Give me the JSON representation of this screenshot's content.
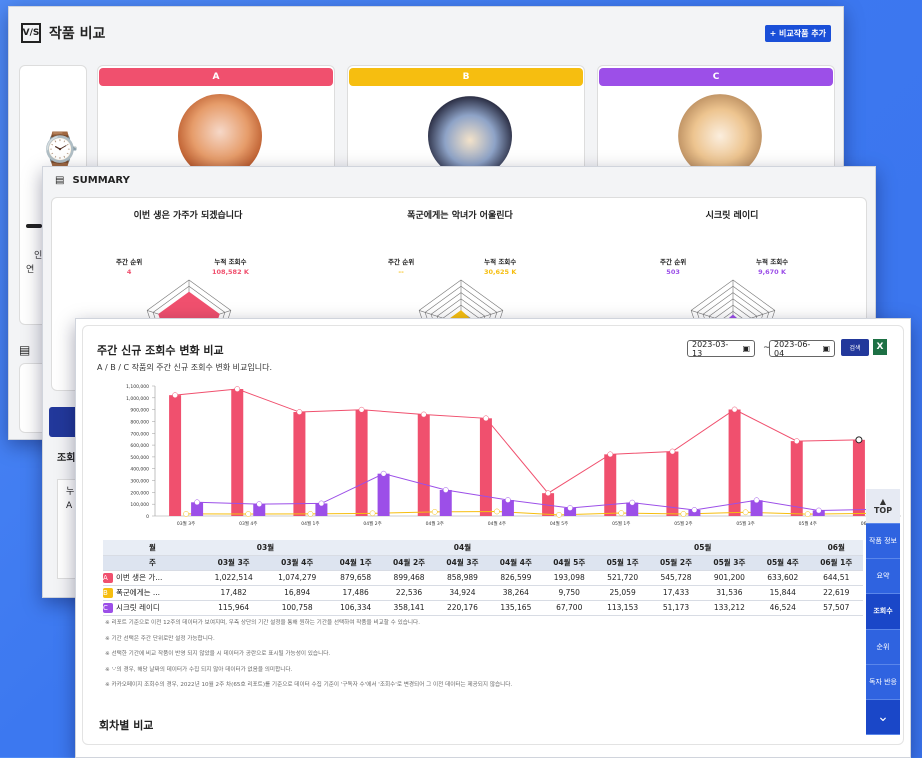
{
  "win1": {
    "title": "작품 비교",
    "add_label": "+ 비교작품 추가",
    "cards": [
      {
        "label": "A",
        "color": "#f0506e"
      },
      {
        "label": "B",
        "color": "#f6be10"
      },
      {
        "label": "C",
        "color": "#9c4fe8"
      }
    ],
    "side_lines": [
      "인",
      "연"
    ],
    "doc_letter": "A"
  },
  "summary": {
    "title": "SUMMARY",
    "works": [
      {
        "title": "이번 생은 가주가 되겠습니다",
        "rank_label": "주간 순위",
        "rank_value": "4",
        "views_label": "누적 조회수",
        "views_value": "108,582 K",
        "color": "#f0506e"
      },
      {
        "title": "폭군에게는 악녀가 어울린다",
        "rank_label": "주간 순위",
        "rank_value": "--",
        "views_label": "누적 조회수",
        "views_value": "30,625 K",
        "color": "#f6be10"
      },
      {
        "title": "시크릿 레이디",
        "rank_label": "주간 순위",
        "rank_value": "503",
        "views_label": "누적 조회수",
        "views_value": "9,670 K",
        "color": "#9c4fe8"
      }
    ],
    "side_label": "조회",
    "side_box_label": "누"
  },
  "weekly": {
    "title": "주간 신규 조회수 변화 비교",
    "subtitle": "A / B / C 작품의 주간 신규 조회수 변화 비교입니다.",
    "date_from": "2023-03-13",
    "date_to": "2023-06-04",
    "tilde": "~",
    "search_label": "검색",
    "excel_label": "X",
    "months": [
      {
        "label": "월"
      },
      {
        "label": "03월"
      },
      {
        "label": "04월"
      },
      {
        "label": "05월"
      },
      {
        "label": "06월"
      }
    ],
    "week_header": "주",
    "weeks": [
      "03월 3주",
      "03월 4주",
      "04월 1주",
      "04월 2주",
      "04월 3주",
      "04월 4주",
      "04월 5주",
      "05월 1주",
      "05월 2주",
      "05월 3주",
      "05월 4주",
      "06월 1주"
    ],
    "rows": [
      {
        "badge": "A",
        "name": "이번 생은 가...",
        "color": "#f0506e",
        "values": [
          "1,022,514",
          "1,074,279",
          "879,658",
          "899,468",
          "858,989",
          "826,599",
          "193,098",
          "521,720",
          "545,728",
          "901,200",
          "633,602",
          "644,51"
        ]
      },
      {
        "badge": "B",
        "name": "폭군에게는 ...",
        "color": "#f6be10",
        "values": [
          "17,482",
          "16,894",
          "17,486",
          "22,536",
          "34,924",
          "38,264",
          "9,750",
          "25,059",
          "17,433",
          "31,536",
          "15,844",
          "22,619"
        ]
      },
      {
        "badge": "C",
        "name": "시크릿 레이디",
        "color": "#9c4fe8",
        "values": [
          "115,964",
          "100,758",
          "106,334",
          "358,141",
          "220,176",
          "135,165",
          "67,700",
          "113,153",
          "51,173",
          "133,212",
          "46,524",
          "57,507"
        ]
      }
    ],
    "notes": [
      "※ 리포트 기준으로 이전 12주의 데이터가 보여지며, 우측 상단의 기간 설정을 통해 원하는 기간을 선택하여 작품을 비교할 수 있습니다.",
      "※ 기간 선택은 주간 단위로만 설정 가능합니다.",
      "※ 선택한 기간에 비교 작품이 반영 되지 않았을 시 데이터가 공란으로 표시될 가능성이 있습니다.",
      "※ '-'의 경우, 해당 날짜의 데이터가 수집 되지 않아 데이터가 없음을 의미합니다.",
      "※ 카카오페이지 조회수의 경우, 2022년 10월 2주 차(65호 리포트)를 기준으로 데이터 수집 기준이 '구독자 수'에서 '조회수'로 변경되어 그 이전 데이터는 제공되지 않습니다."
    ],
    "next_section": "회차별 비교"
  },
  "chart_data": {
    "type": "bar",
    "categories": [
      "03월 3주",
      "03월 4주",
      "04월 1주",
      "04월 2주",
      "04월 3주",
      "04월 4주",
      "04월 5주",
      "05월 1주",
      "05월 2주",
      "05월 3주",
      "05월 4주",
      "06월 1주"
    ],
    "series": [
      {
        "name": "A",
        "values": [
          1022514,
          1074279,
          879658,
          899468,
          858989,
          826599,
          193098,
          521720,
          545728,
          901200,
          633602,
          644510
        ],
        "color": "#f0506e"
      },
      {
        "name": "B",
        "values": [
          17482,
          16894,
          17486,
          22536,
          34924,
          38264,
          9750,
          25059,
          17433,
          31536,
          15844,
          22619
        ],
        "color": "#f6be10"
      },
      {
        "name": "C",
        "values": [
          115964,
          100758,
          106334,
          358141,
          220176,
          135165,
          67700,
          113153,
          51173,
          133212,
          46524,
          57507
        ],
        "color": "#9c4fe8"
      }
    ],
    "x_tick_labels": [
      "03월 3주",
      "03월 4주",
      "04월 1주",
      "04월 2주",
      "04월 3주",
      "04월 4주",
      "04월 5주",
      "05월 1주",
      "05월 2주",
      "05월 3주",
      "05월 4주",
      "06월 1주"
    ],
    "y_tick_labels": [
      "0",
      "100,000",
      "200,000",
      "300,000",
      "400,000",
      "500,000",
      "600,000",
      "700,000",
      "800,000",
      "900,000",
      "1,000,000",
      "1,100,000"
    ],
    "ylim": [
      0,
      1100000
    ],
    "grid": false
  },
  "nav": {
    "items": [
      "TOP",
      "작품 정보",
      "요약",
      "조회수",
      "순위",
      "독자 반응"
    ],
    "active": "조회수"
  }
}
